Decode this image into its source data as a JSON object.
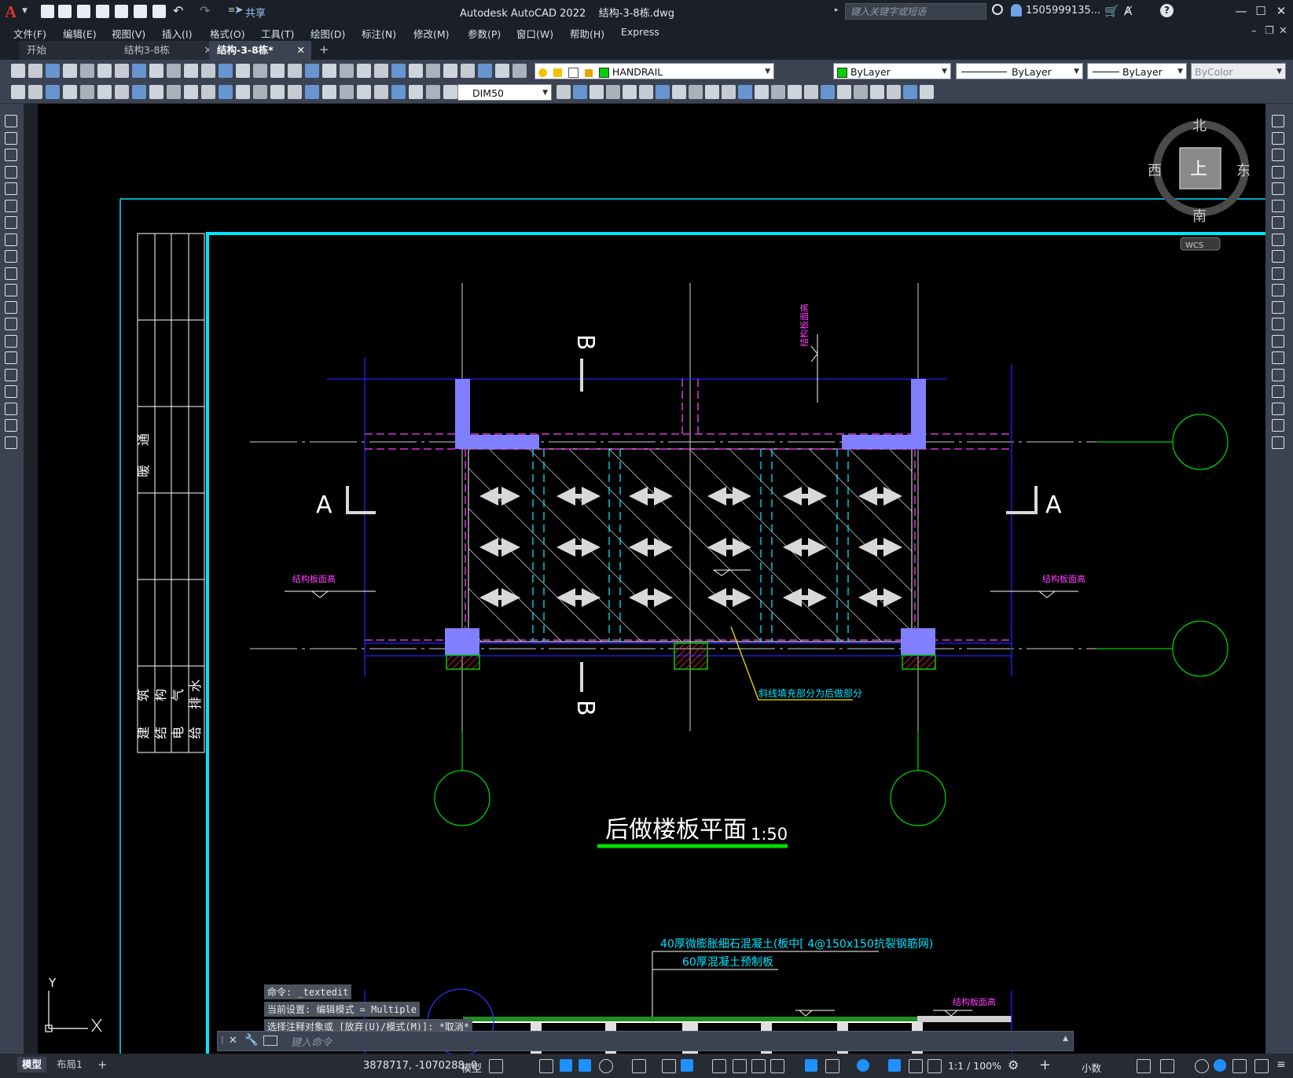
{
  "app": {
    "logo": "A",
    "title": "Autodesk AutoCAD 2022",
    "document": "结构-3-8栋.dwg",
    "share": "共享",
    "search_placeholder": "键入关键字或短语",
    "user": "1505999135...",
    "colors": {
      "accent": "#1e90ff",
      "cyan_frame": "#00e5ff",
      "column_fill": "#8080ff"
    }
  },
  "menu": [
    "文件(F)",
    "编辑(E)",
    "视图(V)",
    "插入(I)",
    "格式(O)",
    "工具(T)",
    "绘图(D)",
    "标注(N)",
    "修改(M)",
    "参数(P)",
    "窗口(W)",
    "帮助(H)",
    "Express"
  ],
  "tabs": [
    {
      "label": "开始",
      "active": false
    },
    {
      "label": "结构3-8栋",
      "active": false
    },
    {
      "label": "结构-3-8栋*",
      "active": true
    }
  ],
  "toolbar": {
    "layer": "HANDRAIL",
    "color": "ByLayer",
    "linetype": "ByLayer",
    "lineweight": "ByLayer",
    "plotstyle": "ByColor",
    "dimstyle": "DIM50"
  },
  "viewcube": {
    "north": "北",
    "south": "南",
    "east": "东",
    "west": "西",
    "top": "上",
    "wcs": "WCS"
  },
  "drawing": {
    "title": "后做楼板平面",
    "scale": "1:50",
    "section_a": "A",
    "section_b": "B",
    "elev_label": "结构板面高",
    "hatch_note": "斜线填充部分为后做部分",
    "note1": "40厚微膨胀细石混凝土(板中[ 4@150x150抗裂钢筋网)",
    "note2": "60厚混凝土预制板",
    "title_block": [
      "暖",
      "通",
      "建",
      "结",
      "电",
      "给",
      "筑",
      "构",
      "气",
      "排",
      "水"
    ],
    "ucs_y": "Y"
  },
  "command": {
    "lines": [
      "命令: _textedit",
      "当前设置: 编辑模式 = Multiple",
      "选择注释对象或 [放弃(U)/模式(M)]: *取消*"
    ],
    "placeholder": "键入命令"
  },
  "status": {
    "tabs": [
      "模型",
      "布局1"
    ],
    "coords": "3878717, -1070288, 0",
    "model": "模型",
    "scale": "1:1 / 100%",
    "units": "小数"
  }
}
